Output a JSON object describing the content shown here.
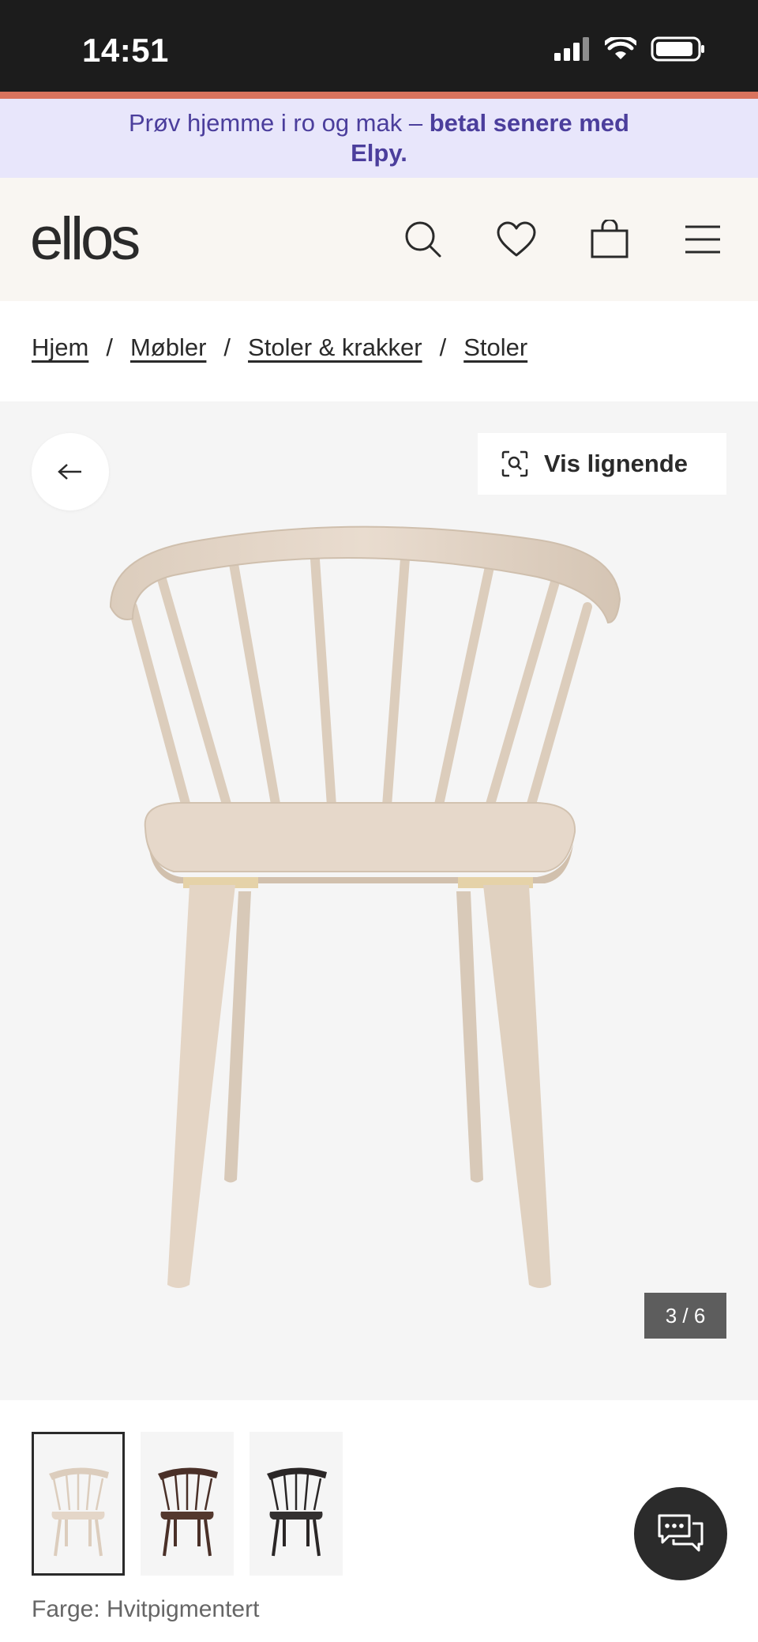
{
  "status_bar": {
    "time": "14:51"
  },
  "promo": {
    "text_regular": "Prøv hjemme i ro og mak – ",
    "text_bold_line1": "betal senere med",
    "text_bold_line2": "Elpy."
  },
  "header": {
    "logo": "ellos"
  },
  "breadcrumb": [
    "Hjem",
    "Møbler",
    "Stoler & krakker",
    "Stoler"
  ],
  "breadcrumb_separator": "/",
  "gallery": {
    "similar_label": "Vis lignende",
    "counter": "3 / 6"
  },
  "thumbnails": [
    {
      "color_name": "light",
      "wood": "#e2d6c8"
    },
    {
      "color_name": "brown",
      "wood": "#4a3028"
    },
    {
      "color_name": "black",
      "wood": "#2a2626"
    }
  ],
  "color_label": "Farge: Hvitpigmentert",
  "colors": {
    "accent": "#d9735d",
    "promo_bg": "#e8e6fb",
    "promo_text": "#4b3e9c",
    "header_bg": "#f9f6f2"
  }
}
